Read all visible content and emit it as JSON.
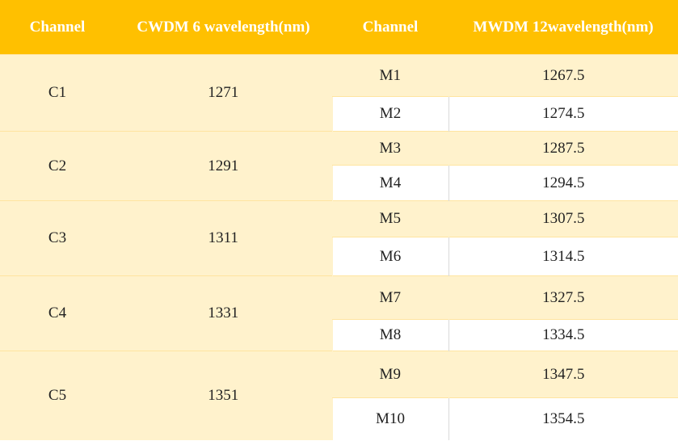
{
  "headers": [
    "Channel",
    "CWDM 6 wavelength(nm)",
    "Channel",
    "MWDM 12wavelength(nm)"
  ],
  "groups": [
    {
      "c": "C1",
      "cw": "1271",
      "m": [
        {
          "ch": "M1",
          "wl": "1267.5"
        },
        {
          "ch": "M2",
          "wl": "1274.5"
        }
      ]
    },
    {
      "c": "C2",
      "cw": "1291",
      "m": [
        {
          "ch": "M3",
          "wl": "1287.5"
        },
        {
          "ch": "M4",
          "wl": "1294.5"
        }
      ]
    },
    {
      "c": "C3",
      "cw": "1311",
      "m": [
        {
          "ch": "M5",
          "wl": "1307.5"
        },
        {
          "ch": "M6",
          "wl": "1314.5"
        }
      ]
    },
    {
      "c": "C4",
      "cw": "1331",
      "m": [
        {
          "ch": "M7",
          "wl": "1327.5"
        },
        {
          "ch": "M8",
          "wl": "1334.5"
        }
      ]
    },
    {
      "c": "C5",
      "cw": "1351",
      "m": [
        {
          "ch": "M9",
          "wl": "1347.5"
        },
        {
          "ch": "M10",
          "wl": "1354.5"
        }
      ]
    }
  ],
  "colors": {
    "header_bg": "#ffc000",
    "header_text": "#ffffff",
    "band": "#fff2cc",
    "white": "#ffffff"
  }
}
